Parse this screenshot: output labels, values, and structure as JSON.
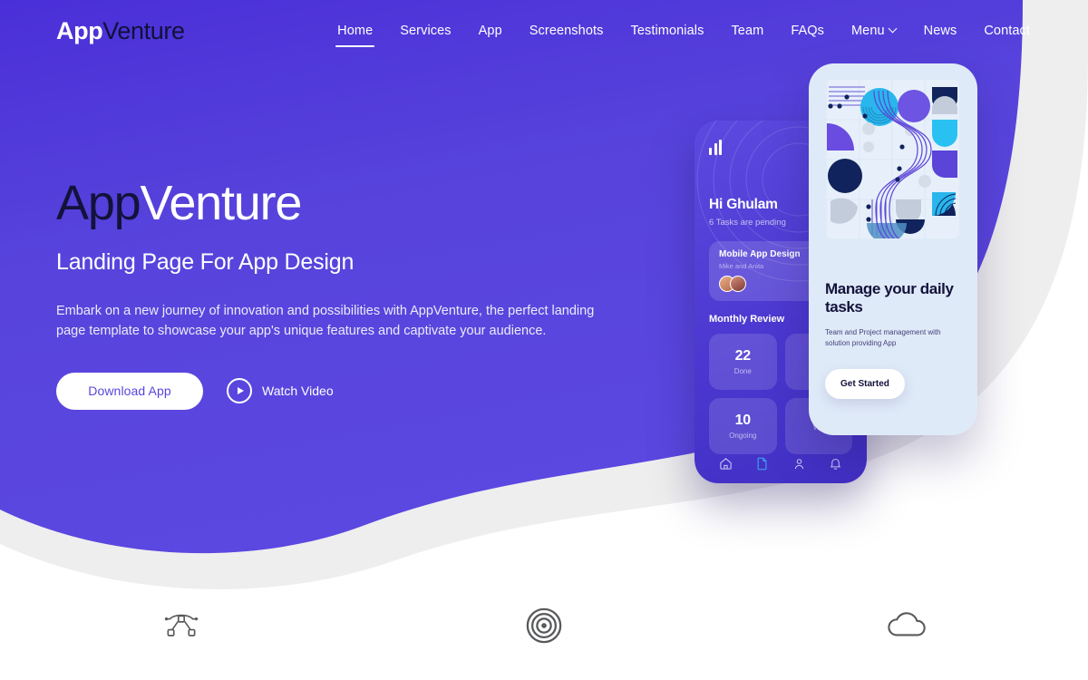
{
  "brand": {
    "logo_bold": "App",
    "logo_light": "Venture",
    "purple": "#5846dc",
    "purple_dark": "#4a2fd8",
    "navy": "#13123b",
    "gray_band": "#eeeeee",
    "phone_front_bg": "#dfeaf8",
    "cyan": "#2bb6ef"
  },
  "nav": {
    "items": [
      {
        "label": "Home",
        "icon": "",
        "active": true
      },
      {
        "label": "Services",
        "icon": "",
        "active": false
      },
      {
        "label": "App",
        "icon": "",
        "active": false
      },
      {
        "label": "Screenshots",
        "icon": "",
        "active": false
      },
      {
        "label": "Testimonials",
        "icon": "",
        "active": false
      },
      {
        "label": "Team",
        "icon": "",
        "active": false
      },
      {
        "label": "FAQs",
        "icon": "",
        "active": false
      },
      {
        "label": "Menu",
        "icon": "chevron-down-icon",
        "active": false
      },
      {
        "label": "News",
        "icon": "",
        "active": false
      },
      {
        "label": "Contact",
        "icon": "",
        "active": false
      }
    ]
  },
  "hero": {
    "title_dark": "App",
    "title_light": "Venture",
    "subtitle": "Landing Page For App Design",
    "description": "Embark on a new journey of innovation and possibilities with AppVenture, the perfect landing page template to showcase your app's unique features and captivate your audience.",
    "primary_button": "Download App",
    "secondary_button": "Watch Video",
    "secondary_icon": "play-icon"
  },
  "phone_back": {
    "logo_icon": "bar-chart-icon",
    "greeting": "Hi Ghulam",
    "pending": "6 Tasks are pending",
    "project_card": {
      "title": "Mobile App Design",
      "members": "Mike and Anita"
    },
    "section_title": "Monthly Review",
    "stats": [
      {
        "value": "22",
        "label": "Done"
      },
      {
        "value": "",
        "label": ""
      },
      {
        "value": "10",
        "label": "Ongoing"
      },
      {
        "value": "",
        "label": "Wa"
      }
    ],
    "bottom_nav": [
      "home-icon",
      "document-icon",
      "person-icon",
      "bell-icon"
    ]
  },
  "phone_front": {
    "artwork": "abstract-geometric-illustration",
    "title": "Manage your daily tasks",
    "description": "Team and Project management with solution providing App",
    "button": "Get Started"
  },
  "features": {
    "items": [
      {
        "icon": "bezier-node-icon"
      },
      {
        "icon": "target-icon"
      },
      {
        "icon": "cloud-icon"
      }
    ]
  }
}
